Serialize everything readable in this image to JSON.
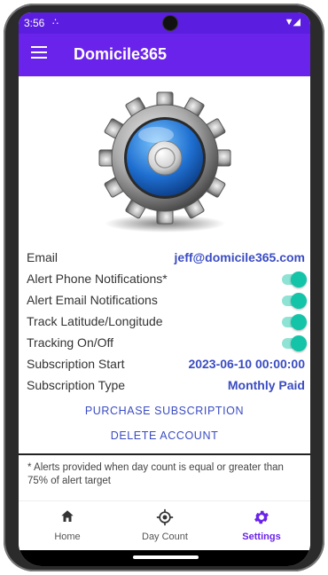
{
  "status_bar": {
    "time": "3:56",
    "vibrate_icon": "vibrate-icon",
    "signal_icon": "signal-icon"
  },
  "app_bar": {
    "title": "Domicile365",
    "menu_icon": "hamburger-menu-icon"
  },
  "settings": {
    "email_label": "Email",
    "email_value": "jeff@domicile365.com",
    "alert_phone_label": "Alert Phone Notifications*",
    "alert_phone_on": true,
    "alert_email_label": "Alert Email Notifications",
    "alert_email_on": true,
    "track_latlng_label": "Track Latitude/Longitude",
    "track_latlng_on": true,
    "tracking_label": "Tracking On/Off",
    "tracking_on": true,
    "sub_start_label": "Subscription Start",
    "sub_start_value": "2023-06-10 00:00:00",
    "sub_type_label": "Subscription Type",
    "sub_type_value": "Monthly Paid"
  },
  "actions": {
    "purchase_label": "PURCHASE SUBSCRIPTION",
    "delete_label": "DELETE ACCOUNT"
  },
  "footnote": "* Alerts provided when day count is equal or greater than 75% of alert target",
  "bottom_nav": {
    "home_label": "Home",
    "day_count_label": "Day Count",
    "settings_label": "Settings",
    "active": "Settings"
  },
  "colors": {
    "accent": "#6a23ea",
    "link": "#3a4cc2",
    "toggle": "#13c4a8"
  }
}
